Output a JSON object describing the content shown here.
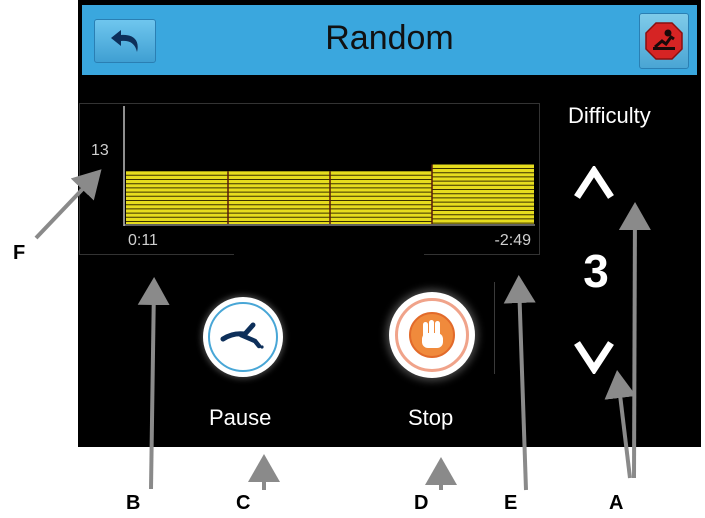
{
  "header": {
    "title": "Random",
    "back_icon": "back-arrow-icon",
    "stop_all_icon": "emergency-stop-icon",
    "bar_color": "#3aa7de"
  },
  "graph": {
    "max_label": "13",
    "elapsed": "0:11",
    "remaining": "-2:49",
    "bar_color": "#e6dc1e",
    "segment_levels": [
      0.62,
      0.62,
      0.62,
      0.7
    ]
  },
  "difficulty": {
    "label": "Difficulty",
    "value": "3",
    "up_icon": "chevron-up-icon",
    "down_icon": "chevron-down-icon"
  },
  "controls": {
    "pause_label": "Pause",
    "stop_label": "Stop",
    "pause_icon": "pause-walker-icon",
    "stop_icon": "stop-hand-icon"
  },
  "callouts": {
    "F": "F",
    "B": "B",
    "C": "C",
    "D": "D",
    "E": "E",
    "A": "A"
  }
}
